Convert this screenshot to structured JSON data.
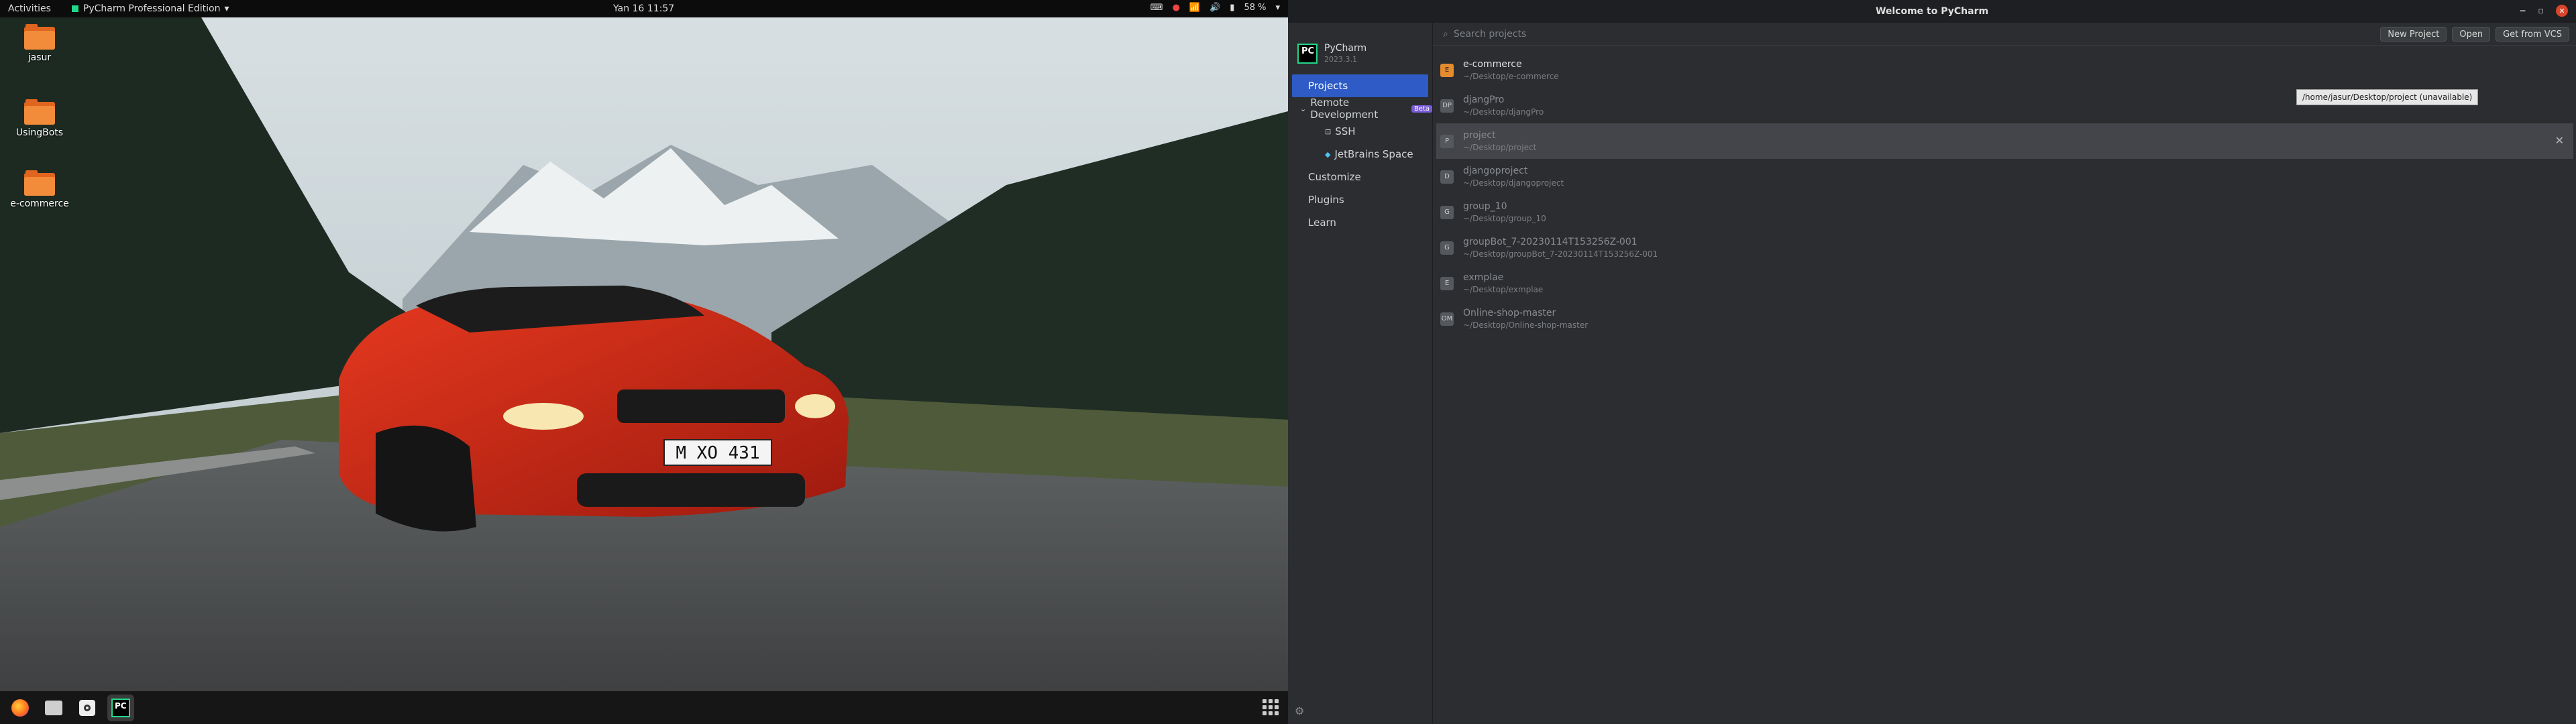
{
  "topbar": {
    "activities": "Activities",
    "app_name": "PyCharm Professional Edition",
    "clock": "Yan 16  11:57",
    "battery": "58 %"
  },
  "desktop": {
    "icons": [
      {
        "label": "jasur"
      },
      {
        "label": "UsingBots"
      },
      {
        "label": "e-commerce"
      }
    ],
    "wallpaper_plate": "M XO 431"
  },
  "pycharm": {
    "window_title": "Welcome to PyCharm",
    "brand_name": "PyCharm",
    "brand_version": "2023.3.1",
    "nav": {
      "projects": "Projects",
      "remote_development": "Remote Development",
      "beta": "Beta",
      "ssh": "SSH",
      "jetbrains_space": "JetBrains Space",
      "customize": "Customize",
      "plugins": "Plugins",
      "learn": "Learn"
    },
    "search_placeholder": "Search projects",
    "buttons": {
      "new_project": "New Project",
      "open": "Open",
      "get_from_vcs": "Get from VCS"
    },
    "projects": [
      {
        "initials": "E",
        "name": "e-commerce",
        "path": "~/Desktop/e-commerce"
      },
      {
        "initials": "DP",
        "name": "djangPro",
        "path": "~/Desktop/djangPro"
      },
      {
        "initials": "P",
        "name": "project",
        "path": "~/Desktop/project"
      },
      {
        "initials": "D",
        "name": "djangoproject",
        "path": "~/Desktop/djangoproject"
      },
      {
        "initials": "G",
        "name": "group_10",
        "path": "~/Desktop/group_10"
      },
      {
        "initials": "G",
        "name": "groupBot_7-20230114T153256Z-001",
        "path": "~/Desktop/groupBot_7-20230114T153256Z-001"
      },
      {
        "initials": "E",
        "name": "exmplae",
        "path": "~/Desktop/exmplae"
      },
      {
        "initials": "OM",
        "name": "Online-shop-master",
        "path": "~/Desktop/Online-shop-master"
      }
    ],
    "tooltip": "/home/jasur/Desktop/project (unavailable)"
  },
  "colors": {
    "accent": "#2e5bc5",
    "folder": "#f28c3a",
    "car": "#d12a16"
  }
}
